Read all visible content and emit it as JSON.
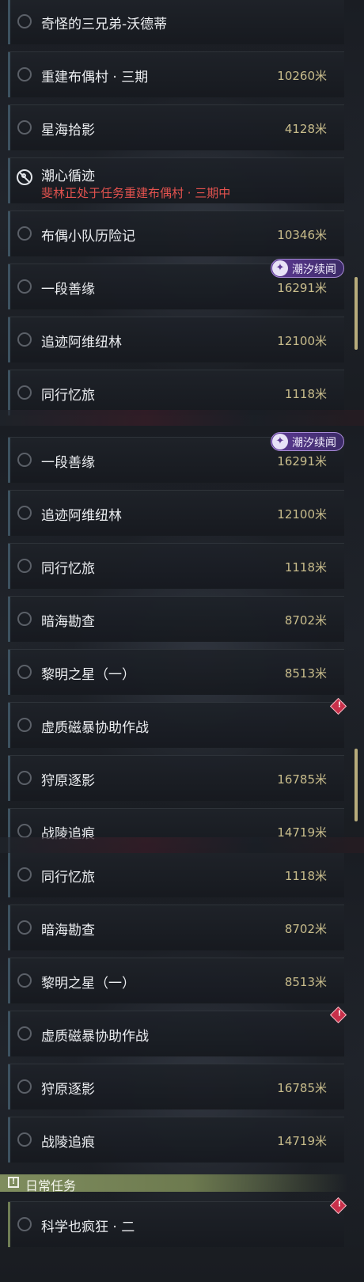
{
  "badge_label": "潮汐续闻",
  "daily_header": "日常任务",
  "colors": {
    "accent_gold": "#c9bd8c",
    "alert_red": "#e2524e",
    "badge_purple": "#5d3a94",
    "daily_green": "#7f8d5e"
  },
  "panel1": {
    "rows": [
      {
        "title": "奇怪的三兄弟-沃德蒂",
        "distance": ""
      },
      {
        "title": "重建布偶村 · 三期",
        "distance": "10260米"
      },
      {
        "title": "星海拾影",
        "distance": "4128米"
      },
      {
        "title": "潮心循迹",
        "subtitle": "斐林正处于任务重建布偶村 · 三期中",
        "distance": ""
      },
      {
        "title": "布偶小队历险记",
        "distance": "10346米"
      },
      {
        "title": "一段善缘",
        "distance": "16291米"
      },
      {
        "title": "追迹阿维纽林",
        "distance": "12100米"
      },
      {
        "title": "同行忆旅",
        "distance": "1118米"
      }
    ]
  },
  "panel2": {
    "rows": [
      {
        "title": "一段善缘",
        "distance": "16291米"
      },
      {
        "title": "追迹阿维纽林",
        "distance": "12100米"
      },
      {
        "title": "同行忆旅",
        "distance": "1118米"
      },
      {
        "title": "暗海勘查",
        "distance": "8702米"
      },
      {
        "title": "黎明之星（一）",
        "distance": "8513米"
      },
      {
        "title": "虚质磁暴协助作战",
        "distance": ""
      },
      {
        "title": "狩原逐影",
        "distance": "16785米"
      },
      {
        "title": "战陵追痕",
        "distance": "14719米"
      }
    ]
  },
  "panel3": {
    "rows": [
      {
        "title": "同行忆旅",
        "distance": "1118米"
      },
      {
        "title": "暗海勘查",
        "distance": "8702米"
      },
      {
        "title": "黎明之星（一）",
        "distance": "8513米"
      },
      {
        "title": "虚质磁暴协助作战",
        "distance": ""
      },
      {
        "title": "狩原逐影",
        "distance": "16785米"
      },
      {
        "title": "战陵追痕",
        "distance": "14719米"
      }
    ],
    "daily": [
      {
        "title": "科学也疯狂 · 二",
        "distance": ""
      }
    ]
  }
}
